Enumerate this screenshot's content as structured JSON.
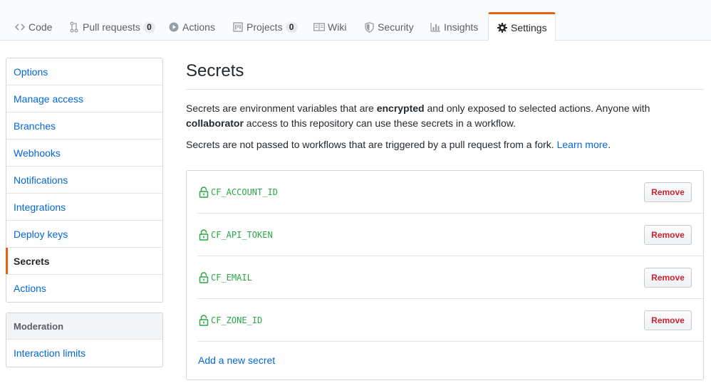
{
  "tabs": [
    {
      "label": "Code",
      "icon": "code-icon"
    },
    {
      "label": "Pull requests",
      "icon": "pull-request-icon",
      "count": "0"
    },
    {
      "label": "Actions",
      "icon": "play-icon"
    },
    {
      "label": "Projects",
      "icon": "project-icon",
      "count": "0"
    },
    {
      "label": "Wiki",
      "icon": "book-icon"
    },
    {
      "label": "Security",
      "icon": "shield-icon"
    },
    {
      "label": "Insights",
      "icon": "graph-icon"
    },
    {
      "label": "Settings",
      "icon": "gear-icon",
      "selected": true
    }
  ],
  "sidebar": {
    "items": [
      {
        "label": "Options"
      },
      {
        "label": "Manage access"
      },
      {
        "label": "Branches"
      },
      {
        "label": "Webhooks"
      },
      {
        "label": "Notifications"
      },
      {
        "label": "Integrations"
      },
      {
        "label": "Deploy keys"
      },
      {
        "label": "Secrets",
        "selected": true
      },
      {
        "label": "Actions"
      }
    ],
    "moderation": {
      "heading": "Moderation",
      "items": [
        {
          "label": "Interaction limits"
        }
      ]
    }
  },
  "main": {
    "title": "Secrets",
    "description": {
      "part1": "Secrets are environment variables that are ",
      "bold1": "encrypted",
      "part2": " and only exposed to selected actions. Anyone with ",
      "bold2": "collaborator",
      "part3": " access to this repository can use these secrets in a workflow."
    },
    "fork_note": {
      "text": "Secrets are not passed to workflows that are triggered by a pull request from a fork. ",
      "link": "Learn more",
      "end": "."
    },
    "secrets": [
      {
        "name": "CF_ACCOUNT_ID"
      },
      {
        "name": "CF_API_TOKEN"
      },
      {
        "name": "CF_EMAIL"
      },
      {
        "name": "CF_ZONE_ID"
      }
    ],
    "remove_label": "Remove",
    "add_label": "Add a new secret"
  },
  "colors": {
    "accent": "#e36209",
    "link": "#0366d6",
    "secret": "#28a745",
    "danger": "#cb2431"
  }
}
